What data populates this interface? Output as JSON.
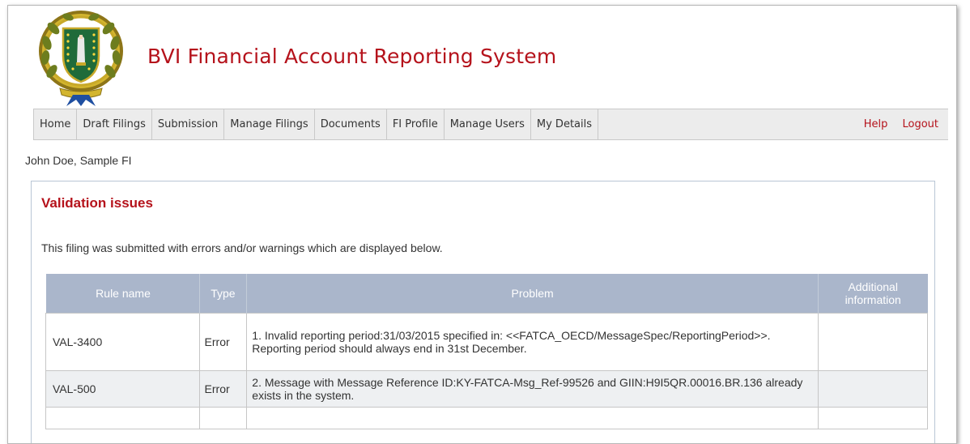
{
  "header": {
    "title": "BVI Financial Account Reporting System"
  },
  "nav": {
    "items": [
      "Home",
      "Draft Filings",
      "Submission",
      "Manage Filings",
      "Documents",
      "FI Profile",
      "Manage Users",
      "My Details"
    ],
    "right": {
      "help": "Help",
      "logout": "Logout"
    }
  },
  "user": {
    "line": "John Doe, Sample FI"
  },
  "panel": {
    "title": "Validation issues",
    "description": "This filing was submitted with errors and/or warnings which are displayed below.",
    "table": {
      "columns": [
        "Rule name",
        "Type",
        "Problem",
        "Additional information"
      ],
      "rows": [
        {
          "rule": "VAL-3400",
          "type": "Error",
          "problem": "1. Invalid reporting period:31/03/2015 specified in: <<FATCA_OECD/MessageSpec/ReportingPeriod>>. Reporting period should always end in 31st December.",
          "additional": ""
        },
        {
          "rule": "VAL-500",
          "type": "Error",
          "problem": "2. Message with Message Reference ID:KY-FATCA-Msg_Ref-99526 and GIIN:H9I5QR.00016.BR.136 already exists in the system.",
          "additional": ""
        }
      ]
    }
  },
  "colors": {
    "brand_red": "#b5121b",
    "table_header_bg": "#aab6cb",
    "nav_bg": "#ececec"
  },
  "icons": {
    "logo": "bvi-coat-of-arms-logo"
  }
}
